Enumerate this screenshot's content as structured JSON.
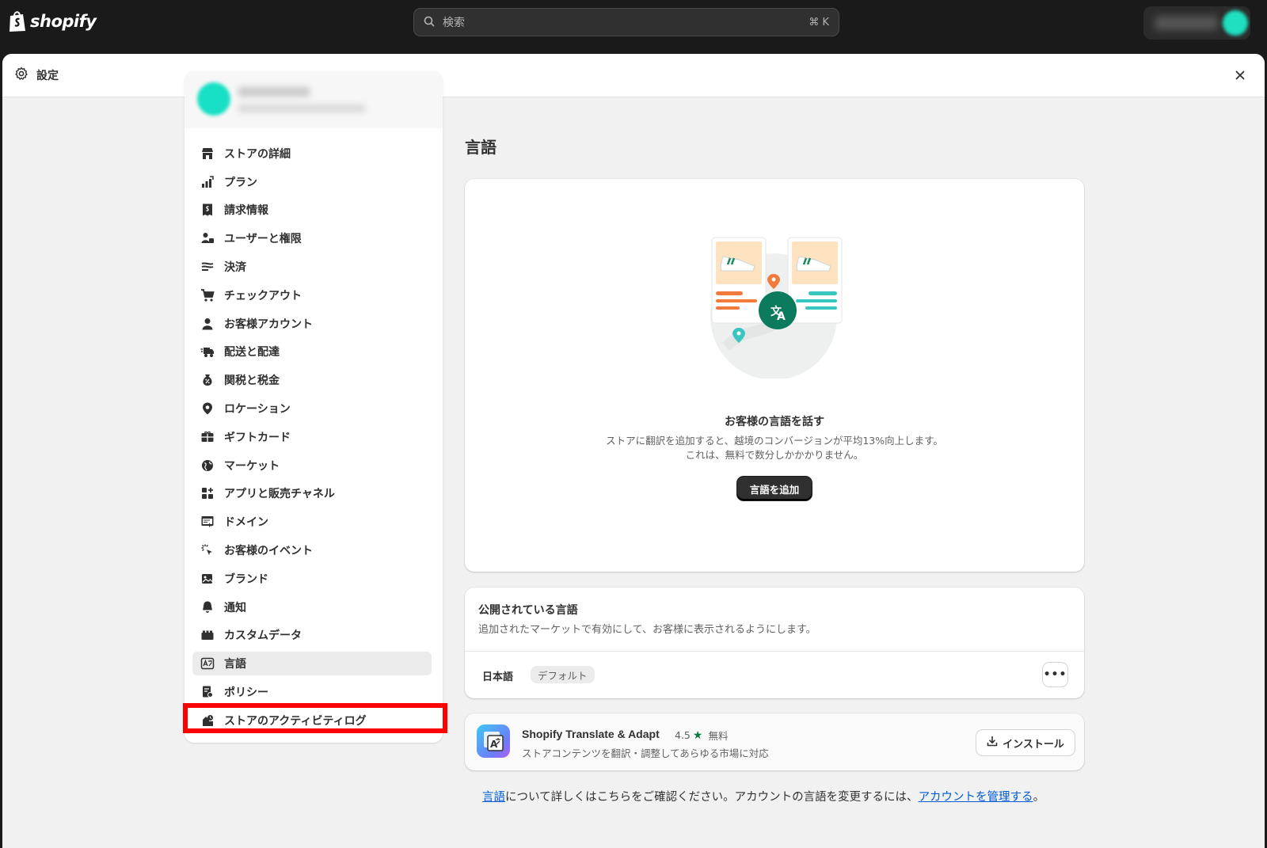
{
  "topbar": {
    "logo_text": "shopify",
    "search_placeholder": "検索",
    "search_shortcut": "⌘ K"
  },
  "window": {
    "title": "設定"
  },
  "sidebar": {
    "items": [
      {
        "label": "ストアの詳細",
        "icon": "store-icon"
      },
      {
        "label": "プラン",
        "icon": "plan-chart-icon"
      },
      {
        "label": "請求情報",
        "icon": "receipt-icon"
      },
      {
        "label": "ユーザーと権限",
        "icon": "users-icon"
      },
      {
        "label": "決済",
        "icon": "payments-icon"
      },
      {
        "label": "チェックアウト",
        "icon": "cart-icon"
      },
      {
        "label": "お客様アカウント",
        "icon": "person-icon"
      },
      {
        "label": "配送と配達",
        "icon": "truck-icon"
      },
      {
        "label": "関税と税金",
        "icon": "tax-bag-icon"
      },
      {
        "label": "ロケーション",
        "icon": "location-pin-icon"
      },
      {
        "label": "ギフトカード",
        "icon": "gift-card-icon"
      },
      {
        "label": "マーケット",
        "icon": "globe-icon"
      },
      {
        "label": "アプリと販売チャネル",
        "icon": "apps-icon"
      },
      {
        "label": "ドメイン",
        "icon": "domain-icon"
      },
      {
        "label": "お客様のイベント",
        "icon": "cursor-click-icon"
      },
      {
        "label": "ブランド",
        "icon": "brand-image-icon"
      },
      {
        "label": "通知",
        "icon": "bell-icon"
      },
      {
        "label": "カスタムデータ",
        "icon": "custom-data-icon"
      },
      {
        "label": "言語",
        "icon": "language-icon",
        "active": true
      },
      {
        "label": "ポリシー",
        "icon": "policy-icon"
      },
      {
        "label": "ストアのアクティビティログ",
        "icon": "activity-log-icon"
      }
    ]
  },
  "main": {
    "page_title": "言語",
    "hero": {
      "title": "お客様の言語を話す",
      "description": "ストアに翻訳を追加すると、越境のコンバージョンが平均13%向上します。これは、無料で数分しかかかりません。",
      "button_label": "言語を追加"
    },
    "published_languages": {
      "title": "公開されている言語",
      "description": "追加されたマーケットで有効にして、お客様に表示されるようにします。",
      "language": "日本語",
      "badge": "デフォルト",
      "more_label": "•••"
    },
    "app": {
      "name": "Shopify Translate & Adapt",
      "rating": "4.5",
      "price": "無料",
      "description": "ストアコンテンツを翻訳・調整してあらゆる市場に対応",
      "install_label": "インストール"
    },
    "footnote": {
      "link1": "言語",
      "text1": "について詳しくはこちらをご確認ください。アカウントの言語を変更するには、",
      "link2": "アカウントを管理する",
      "text2": "。"
    }
  },
  "colors": {
    "topbar": "#1a1a1a",
    "highlight": "#ff0000",
    "accent_green": "#0c7a43",
    "link": "#005bd3"
  }
}
